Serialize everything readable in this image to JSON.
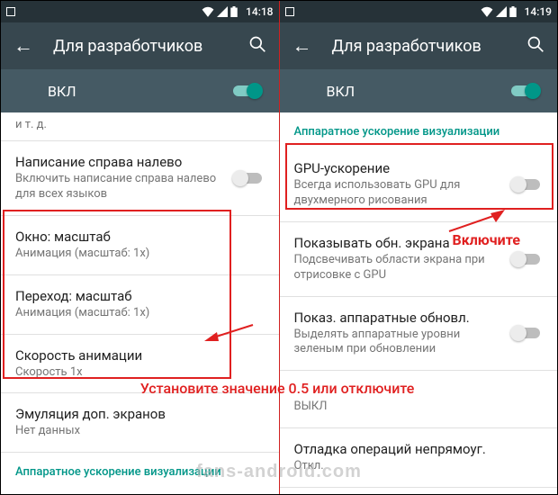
{
  "left": {
    "status_time": "14:18",
    "app_title": "Для разработчиков",
    "vkl_label": "ВКЛ",
    "etc": "и т. д.",
    "rtl": {
      "title": "Написание справа налево",
      "sub": "Включить написание справа налево для всех языков"
    },
    "win": {
      "title": "Окно: масштаб",
      "sub": "Анимация (масштаб: 1x)"
    },
    "trans": {
      "title": "Переход: масштаб",
      "sub": "Анимация (масштаб: 1x)"
    },
    "speed": {
      "title": "Скорость анимации",
      "sub": "Скорость 1x"
    },
    "emul": {
      "title": "Эмуляция доп. экранов",
      "sub": "Нет данных"
    },
    "hw_header": "Аппаратное ускорение визуализации"
  },
  "right": {
    "status_time": "14:19",
    "app_title": "Для разработчиков",
    "vkl_label": "ВКЛ",
    "hw_header": "Аппаратное ускорение визуализации",
    "gpu": {
      "title": "GPU-ускорение",
      "sub": "Всегда использовать GPU для двухмерного рисования"
    },
    "show": {
      "title": "Показывать обн. экрана",
      "sub": "Подсвечивать области экрана при отрисовке с GPU"
    },
    "hwupd": {
      "title": "Показ. аппаратные обновл.",
      "sub": "Выделять аппаратные уровни зеленым при обновлении"
    },
    "over": {
      "title": "",
      "sub": "ВЫКЛ"
    },
    "last": {
      "title": "Отладка операций непрямоуг.",
      "sub": "Откл."
    }
  },
  "annotations": {
    "bottom": "Установите значение 0.5 или отключите",
    "right": "Включите"
  },
  "watermark": "fans-android.com"
}
